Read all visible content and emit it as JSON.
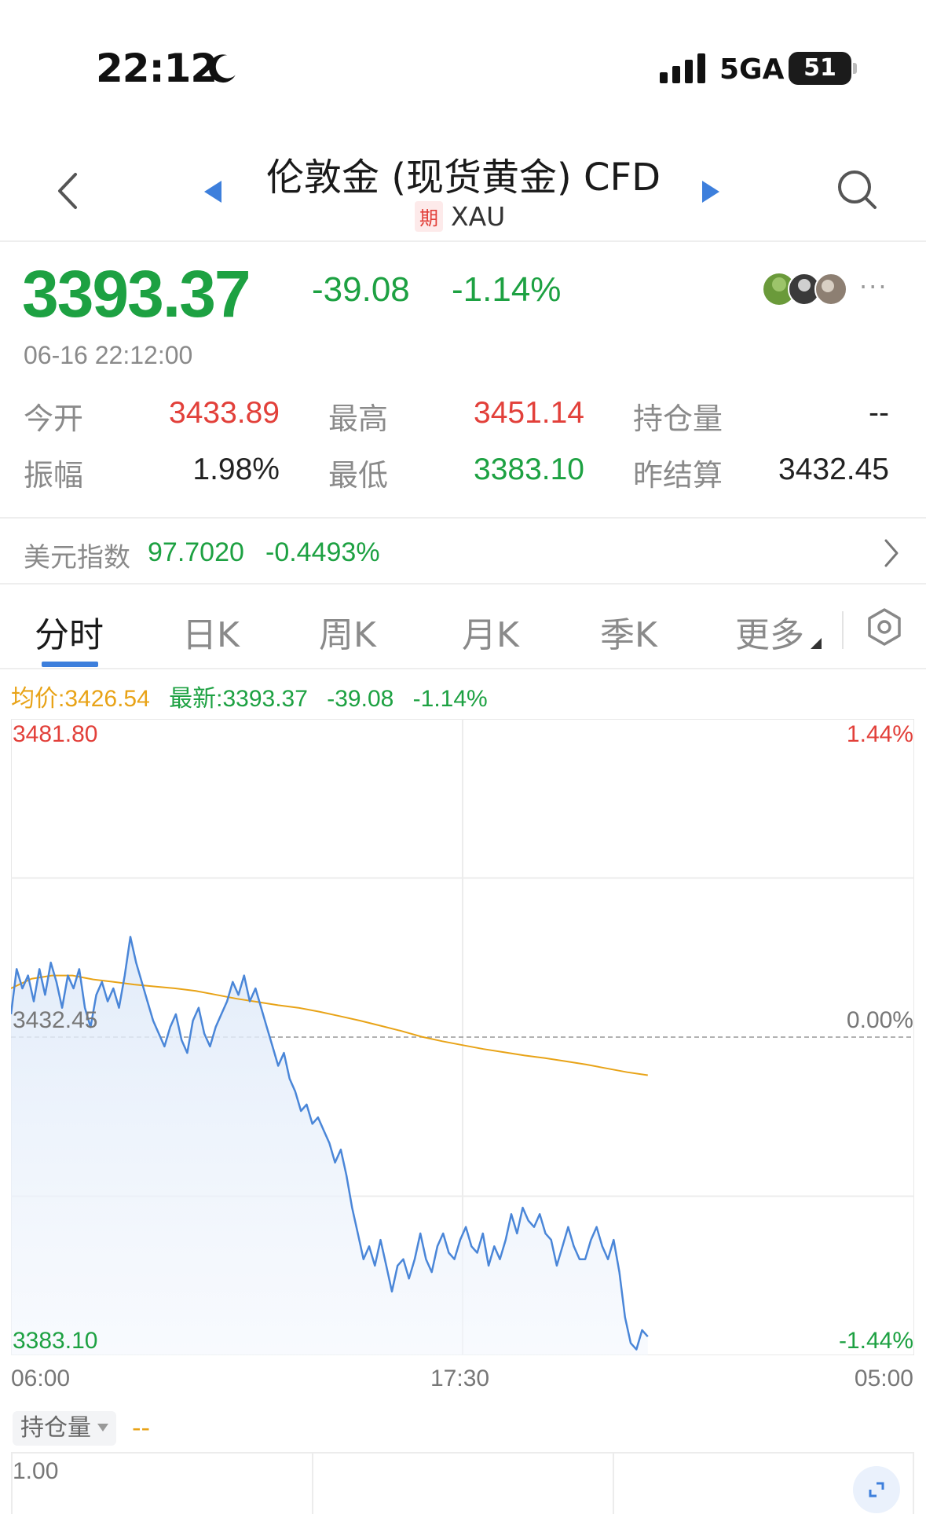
{
  "status_bar": {
    "time": "22:12",
    "network": "5GA",
    "battery": "51",
    "icons": [
      "moon-icon",
      "signal-icon",
      "battery-icon"
    ]
  },
  "header": {
    "title": "伦敦金 (现货黄金) CFD",
    "badge": "期",
    "symbol": "XAU",
    "icons": [
      "back-icon",
      "prev-triangle-icon",
      "next-triangle-icon",
      "search-icon"
    ]
  },
  "quote": {
    "price": "3393.37",
    "change": "-39.08",
    "change_pct": "-1.14%",
    "datetime": "06-16 22:12:00",
    "more": "···"
  },
  "stats": {
    "open_label": "今开",
    "open": "3433.89",
    "high_label": "最高",
    "high": "3451.14",
    "oi_label": "持仓量",
    "oi": "--",
    "amp_label": "振幅",
    "amp": "1.98%",
    "low_label": "最低",
    "low": "3383.10",
    "prev_label": "昨结算",
    "prev": "3432.45"
  },
  "usd_index": {
    "label": "美元指数",
    "value": "97.7020",
    "change_pct": "-0.4493%"
  },
  "tabs": [
    {
      "label": "分时",
      "active": true
    },
    {
      "label": "日K"
    },
    {
      "label": "周K"
    },
    {
      "label": "月K"
    },
    {
      "label": "季K"
    },
    {
      "label": "更多"
    }
  ],
  "legend": {
    "avg": "均价:3426.54",
    "latest": "最新:3393.37",
    "change": "-39.08",
    "change_pct": "-1.14%"
  },
  "colors": {
    "up": "#e2403a",
    "down": "#1da142",
    "price_line": "#4a86d8",
    "avg_line": "#e8a317",
    "accent": "#3d7fdc"
  },
  "chart_data": {
    "type": "line",
    "y_left_ticks": [
      "3481.80",
      "3432.45",
      "3383.10"
    ],
    "y_right_ticks": [
      "1.44%",
      "0.00%",
      "-1.44%"
    ],
    "ylim": [
      3383.1,
      3481.8
    ],
    "reference": 3432.45,
    "x_ticks": [
      "06:00",
      "17:30",
      "05:00"
    ],
    "series": [
      {
        "name": "最新",
        "color": "#4a86d8",
        "values": [
          3436,
          3443,
          3440,
          3442,
          3438,
          3443,
          3439,
          3444,
          3441,
          3437,
          3442,
          3440,
          3443,
          3437,
          3434,
          3439,
          3441,
          3438,
          3440,
          3437,
          3442,
          3448,
          3444,
          3441,
          3438,
          3435,
          3433,
          3431,
          3434,
          3436,
          3432,
          3430,
          3435,
          3437,
          3433,
          3431,
          3434,
          3436,
          3438,
          3441,
          3439,
          3442,
          3438,
          3440,
          3437,
          3434,
          3431,
          3428,
          3430,
          3426,
          3424,
          3421,
          3422,
          3419,
          3420,
          3418,
          3416,
          3413,
          3415,
          3411,
          3406,
          3402,
          3398,
          3400,
          3397,
          3401,
          3397,
          3393,
          3397,
          3398,
          3395,
          3398,
          3402,
          3398,
          3396,
          3400,
          3402,
          3399,
          3398,
          3401,
          3403,
          3400,
          3399,
          3402,
          3397,
          3400,
          3398,
          3401,
          3405,
          3402,
          3406,
          3404,
          3403,
          3405,
          3402,
          3401,
          3397,
          3400,
          3403,
          3400,
          3398,
          3398,
          3401,
          3403,
          3400,
          3398,
          3401,
          3396,
          3389,
          3385,
          3384,
          3387,
          3386
        ]
      },
      {
        "name": "均价",
        "color": "#e8a317",
        "values": [
          3440,
          3441.5,
          3442,
          3442,
          3441.4,
          3441,
          3440.6,
          3440.3,
          3440,
          3439.6,
          3439,
          3438.4,
          3437.9,
          3437.4,
          3437,
          3436.4,
          3435.7,
          3435,
          3434.2,
          3433.4,
          3432.5,
          3431.8,
          3431.2,
          3430.6,
          3430.1,
          3429.6,
          3429.2,
          3428.7,
          3428.2,
          3427.6,
          3427,
          3426.54
        ]
      }
    ]
  },
  "open_interest": {
    "label": "持仓量",
    "value": "--",
    "tick": "1.00"
  }
}
